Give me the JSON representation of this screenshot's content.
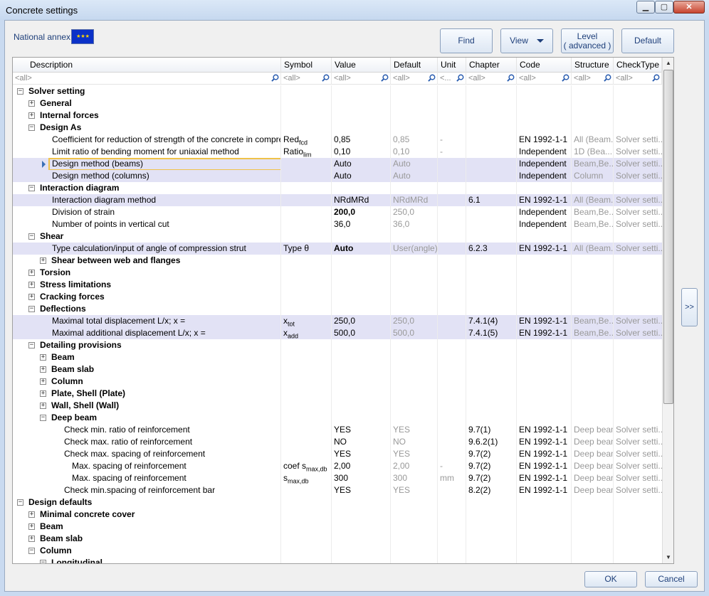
{
  "window": {
    "title": "Concrete settings",
    "min_label": "▁",
    "max_label": "▢",
    "close_label": "✕"
  },
  "toolbar": {
    "national_annex_label": "National annex:",
    "flag_icon": "eu-flag-icon",
    "flag_text": "★ ★ ★",
    "find": "Find",
    "view": "View",
    "level_line1": "Level",
    "level_line2": "( advanced )",
    "default": "Default"
  },
  "columns": [
    "Description",
    "Symbol",
    "Value",
    "Default",
    "Unit",
    "Chapter",
    "Code",
    "Structure",
    "CheckType"
  ],
  "filters": [
    "<all>",
    "<all>",
    "<all>",
    "<all>",
    "<...",
    "<all>",
    "<all>",
    "<all>",
    "<all>"
  ],
  "rows": [
    {
      "lvl": 0,
      "exp": "−",
      "d": "Solver setting",
      "b": true
    },
    {
      "lvl": 1,
      "exp": "+",
      "d": "General",
      "b": true
    },
    {
      "lvl": 1,
      "exp": "+",
      "d": "Internal forces",
      "b": true
    },
    {
      "lvl": 1,
      "exp": "−",
      "d": "Design As",
      "b": true
    },
    {
      "lvl": 2,
      "d": "Coefficient for reduction of strength of the concrete in compressive...",
      "sym": "Red",
      "sub": "fcd",
      "val": "0,85",
      "def": "0,85",
      "unit": "-",
      "code": "EN 1992-1-1",
      "struct": "All (Beam...",
      "check": "Solver setti..."
    },
    {
      "lvl": 2,
      "d": "Limit ratio of bending moment for uniaxial method",
      "sym": "Ratio",
      "sub": "lim",
      "val": "0,10",
      "def": "0,10",
      "unit": "-",
      "code": "Independent",
      "struct": "1D (Bea...",
      "check": "Solver setti..."
    },
    {
      "lvl": 2,
      "d": "Design method (beams)",
      "val": "Auto",
      "def": "Auto",
      "code": "Independent",
      "struct": "Beam,Be...",
      "check": "Solver setti...",
      "hl": true,
      "focus": true
    },
    {
      "lvl": 2,
      "d": "Design method (columns)",
      "val": "Auto",
      "def": "Auto",
      "code": "Independent",
      "struct": "Column",
      "check": "Solver setti...",
      "hl": true
    },
    {
      "lvl": 1,
      "exp": "−",
      "d": "Interaction diagram",
      "b": true
    },
    {
      "lvl": 2,
      "d": "Interaction diagram method",
      "val": "NRdMRd",
      "def": "NRdMRd",
      "chap": "6.1",
      "code": "EN 1992-1-1",
      "struct": "All (Beam...",
      "check": "Solver setti...",
      "hl": true
    },
    {
      "lvl": 2,
      "d": "Division of strain",
      "val": "200,0",
      "vb": true,
      "def": "250,0",
      "code": "Independent",
      "struct": "Beam,Be...",
      "check": "Solver setti..."
    },
    {
      "lvl": 2,
      "d": "Number of points in vertical cut",
      "val": "36,0",
      "def": "36,0",
      "code": "Independent",
      "struct": "Beam,Be...",
      "check": "Solver setti..."
    },
    {
      "lvl": 1,
      "exp": "−",
      "d": "Shear",
      "b": true
    },
    {
      "lvl": 2,
      "d": "Type calculation/input of angle of compression strut",
      "sym": "Type θ",
      "val": "Auto",
      "vb": true,
      "def": "User(angle)",
      "chap": "6.2.3",
      "code": "EN 1992-1-1",
      "struct": "All (Beam...",
      "check": "Solver setti...",
      "hl": true
    },
    {
      "lvl": 2,
      "exp": "+",
      "d": "Shear between web and flanges",
      "b": true
    },
    {
      "lvl": 1,
      "exp": "+",
      "d": "Torsion",
      "b": true
    },
    {
      "lvl": 1,
      "exp": "+",
      "d": "Stress limitations",
      "b": true
    },
    {
      "lvl": 1,
      "exp": "+",
      "d": "Cracking forces",
      "b": true
    },
    {
      "lvl": 1,
      "exp": "−",
      "d": "Deflections",
      "b": true
    },
    {
      "lvl": 2,
      "d": "Maximal total displacement L/x; x =",
      "sym": "x",
      "sub": "tot",
      "val": "250,0",
      "def": "250,0",
      "chap": "7.4.1(4)",
      "code": "EN 1992-1-1",
      "struct": "Beam,Be...",
      "check": "Solver setti...",
      "hl": true
    },
    {
      "lvl": 2,
      "d": "Maximal additional displacement L/x; x =",
      "sym": "x",
      "sub": "add",
      "val": "500,0",
      "def": "500,0",
      "chap": "7.4.1(5)",
      "code": "EN 1992-1-1",
      "struct": "Beam,Be...",
      "check": "Solver setti...",
      "hl": true
    },
    {
      "lvl": 1,
      "exp": "−",
      "d": "Detailing provisions",
      "b": true
    },
    {
      "lvl": 2,
      "exp": "+",
      "d": "Beam",
      "b": true
    },
    {
      "lvl": 2,
      "exp": "+",
      "d": "Beam slab",
      "b": true
    },
    {
      "lvl": 2,
      "exp": "+",
      "d": "Column",
      "b": true
    },
    {
      "lvl": 2,
      "exp": "+",
      "d": "Plate, Shell (Plate)",
      "b": true
    },
    {
      "lvl": 2,
      "exp": "+",
      "d": "Wall, Shell (Wall)",
      "b": true
    },
    {
      "lvl": 2,
      "exp": "−",
      "d": "Deep beam",
      "b": true
    },
    {
      "lvl": 3,
      "d": "Check min. ratio of reinforcement",
      "val": "YES",
      "def": "YES",
      "chap": "9.7(1)",
      "code": "EN 1992-1-1",
      "struct": "Deep beam",
      "check": "Solver setti..."
    },
    {
      "lvl": 3,
      "d": "Check max. ratio of reinforcement",
      "val": "NO",
      "def": "NO",
      "chap": "9.6.2(1)",
      "code": "EN 1992-1-1",
      "struct": "Deep beam",
      "check": "Solver setti..."
    },
    {
      "lvl": 3,
      "d": "Check max. spacing of reinforcement",
      "val": "YES",
      "def": "YES",
      "chap": "9.7(2)",
      "code": "EN 1992-1-1",
      "struct": "Deep beam",
      "check": "Solver setti..."
    },
    {
      "lvl": 4,
      "d": "Max. spacing of reinforcement",
      "sym": "coef s",
      "sub": "max,db",
      "val": "2,00",
      "def": "2,00",
      "unit": "-",
      "chap": "9.7(2)",
      "code": "EN 1992-1-1",
      "struct": "Deep beam",
      "check": "Solver setti..."
    },
    {
      "lvl": 4,
      "d": "Max. spacing of reinforcement",
      "sym": "s",
      "sub": "max,db",
      "val": "300",
      "def": "300",
      "unit": "mm",
      "chap": "9.7(2)",
      "code": "EN 1992-1-1",
      "struct": "Deep beam",
      "check": "Solver setti..."
    },
    {
      "lvl": 3,
      "d": "Check min.spacing of reinforcement bar",
      "val": "YES",
      "def": "YES",
      "chap": "8.2(2)",
      "code": "EN 1992-1-1",
      "struct": "Deep beam",
      "check": "Solver setti..."
    },
    {
      "lvl": 0,
      "exp": "−",
      "d": "Design defaults",
      "b": true
    },
    {
      "lvl": 1,
      "exp": "+",
      "d": "Minimal concrete cover",
      "b": true
    },
    {
      "lvl": 1,
      "exp": "+",
      "d": "Beam",
      "b": true
    },
    {
      "lvl": 1,
      "exp": "+",
      "d": "Beam slab",
      "b": true
    },
    {
      "lvl": 1,
      "exp": "−",
      "d": "Column",
      "b": true
    },
    {
      "lvl": 2,
      "exp": "−",
      "d": "Longitudinal",
      "b": true
    }
  ],
  "scroll": {
    "up": "▲",
    "down": "▼"
  },
  "side_button": ">>",
  "footer": {
    "ok": "OK",
    "cancel": "Cancel"
  }
}
